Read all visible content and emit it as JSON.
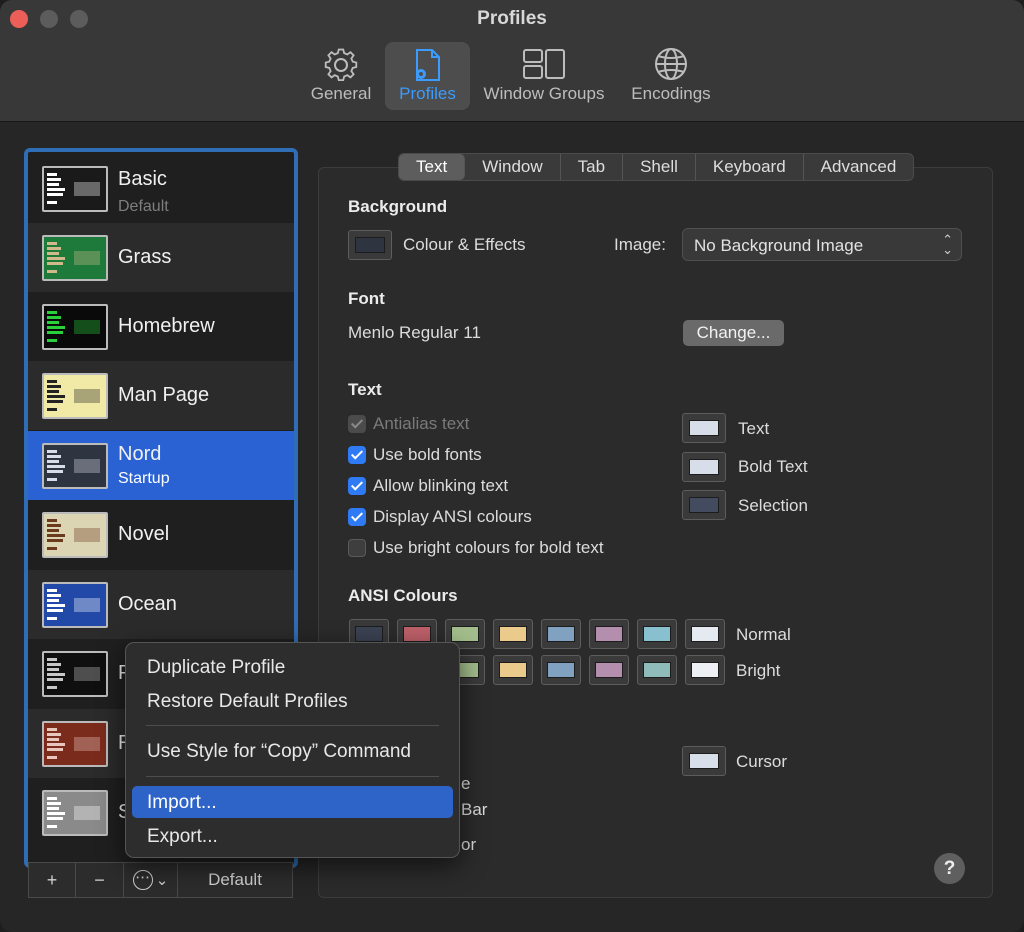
{
  "window": {
    "title": "Profiles"
  },
  "toolbar": {
    "items": [
      {
        "label": "General",
        "icon": "gear-icon"
      },
      {
        "label": "Profiles",
        "icon": "profile-document-icon",
        "active": true
      },
      {
        "label": "Window Groups",
        "icon": "window-groups-icon"
      },
      {
        "label": "Encodings",
        "icon": "globe-icon"
      }
    ]
  },
  "profiles": [
    {
      "name": "Basic",
      "subtitle": "Default",
      "bg": "#1a1a1a",
      "accent": "#ffffff"
    },
    {
      "name": "Grass",
      "subtitle": "",
      "bg": "#1d7a3b",
      "accent": "#d0b98a"
    },
    {
      "name": "Homebrew",
      "subtitle": "",
      "bg": "#0a0a0a",
      "accent": "#28d13c"
    },
    {
      "name": "Man Page",
      "subtitle": "",
      "bg": "#f1e9a6",
      "accent": "#222222"
    },
    {
      "name": "Nord",
      "subtitle": "Startup",
      "bg": "#2e3440",
      "accent": "#d8dee9"
    },
    {
      "name": "Novel",
      "subtitle": "",
      "bg": "#dcd5b4",
      "accent": "#6b3a1e"
    },
    {
      "name": "Ocean",
      "subtitle": "",
      "bg": "#2349a8",
      "accent": "#ffffff"
    },
    {
      "name": "P",
      "subtitle": "",
      "bg": "#0f0f0f",
      "accent": "#c7c7c7"
    },
    {
      "name": "R",
      "subtitle": "",
      "bg": "#7b2b1c",
      "accent": "#e8c6bd"
    },
    {
      "name": "S",
      "subtitle": "",
      "bg": "#8a8a8a",
      "accent": "#ffffff"
    }
  ],
  "list_buttons": {
    "add": "+",
    "remove": "−",
    "action": "⋯",
    "action_chev": "⌄",
    "default": "Default"
  },
  "tabs": [
    "Text",
    "Window",
    "Tab",
    "Shell",
    "Keyboard",
    "Advanced"
  ],
  "background": {
    "heading": "Background",
    "colour_effects": "Colour & Effects",
    "image_label": "Image:",
    "image_value": "No Background Image",
    "swatch": "#2e3440"
  },
  "font": {
    "heading": "Font",
    "value": "Menlo Regular 11",
    "change_button": "Change..."
  },
  "text": {
    "heading": "Text",
    "options": [
      {
        "label": "Antialias text",
        "state": "disabled"
      },
      {
        "label": "Use bold fonts",
        "state": "on"
      },
      {
        "label": "Allow blinking text",
        "state": "on"
      },
      {
        "label": "Display ANSI colours",
        "state": "on"
      },
      {
        "label": "Use bright colours for bold text",
        "state": "off"
      }
    ],
    "colour_wells": [
      {
        "label": "Text",
        "color": "#d8dee9"
      },
      {
        "label": "Bold Text",
        "color": "#d8dee9"
      },
      {
        "label": "Selection",
        "color": "#434c5e"
      }
    ]
  },
  "ansi": {
    "heading": "ANSI Colours",
    "normal_label": "Normal",
    "bright_label": "Bright",
    "normal": [
      "#3b4252",
      "#bf616a",
      "#a3be8c",
      "#ebcb8b",
      "#81a1c1",
      "#b48ead",
      "#88c0d0",
      "#e5e9f0"
    ],
    "bright": [
      "#4c566a",
      "#bf616a",
      "#a3be8c",
      "#ebcb8b",
      "#81a1c1",
      "#b48ead",
      "#8fbcbb",
      "#eceff4"
    ]
  },
  "cursor": {
    "label": "Cursor",
    "color": "#d8dee9",
    "partial_1": "e",
    "partial_2": "Bar",
    "partial_3": "or"
  },
  "help": "?",
  "context_menu": {
    "items": [
      "Duplicate Profile",
      "Restore Default Profiles",
      "Use Style for “Copy” Command",
      "Import...",
      "Export..."
    ],
    "highlighted": "Import..."
  }
}
